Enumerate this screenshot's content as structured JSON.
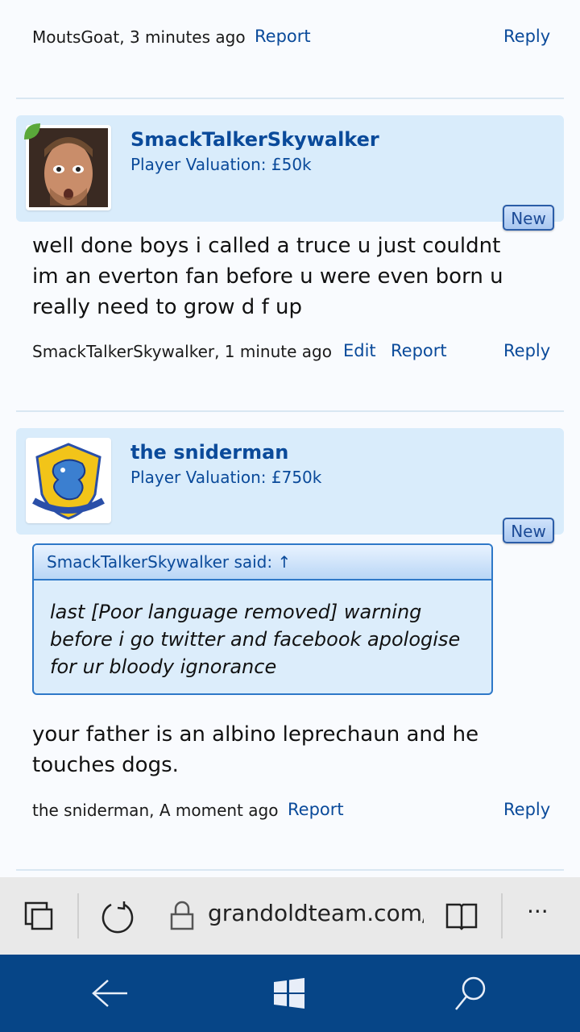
{
  "top_comment": {
    "meta": "MoutsGoat, 3 minutes ago",
    "report": "Report",
    "reply": "Reply"
  },
  "post1": {
    "username": "SmackTalkerSkywalker",
    "valuation": "Player Valuation: £50k",
    "badge": "New",
    "body": "well done boys i called a truce u just couldnt im an everton fan before u were even born u really need to grow d f up",
    "meta": "SmackTalkerSkywalker, 1 minute ago",
    "edit": "Edit",
    "report": "Report",
    "reply": "Reply"
  },
  "post2": {
    "username": "the sniderman",
    "valuation": "Player Valuation: £750k",
    "badge": "New",
    "quote_header": "SmackTalkerSkywalker said: ↑",
    "quote_body": "last [Poor language removed] warning before i go twitter and facebook apologise for ur bloody ignorance",
    "body": "your father is an albino leprechaun and he touches dogs.",
    "meta": "the sniderman, A moment ago",
    "report": "Report",
    "reply": "Reply"
  },
  "browser": {
    "url": "grandoldteam.com/t",
    "more": "···"
  },
  "colors": {
    "link": "#0a4a9a",
    "header_bg": "#d9ecfb",
    "taskbar": "#064587"
  }
}
